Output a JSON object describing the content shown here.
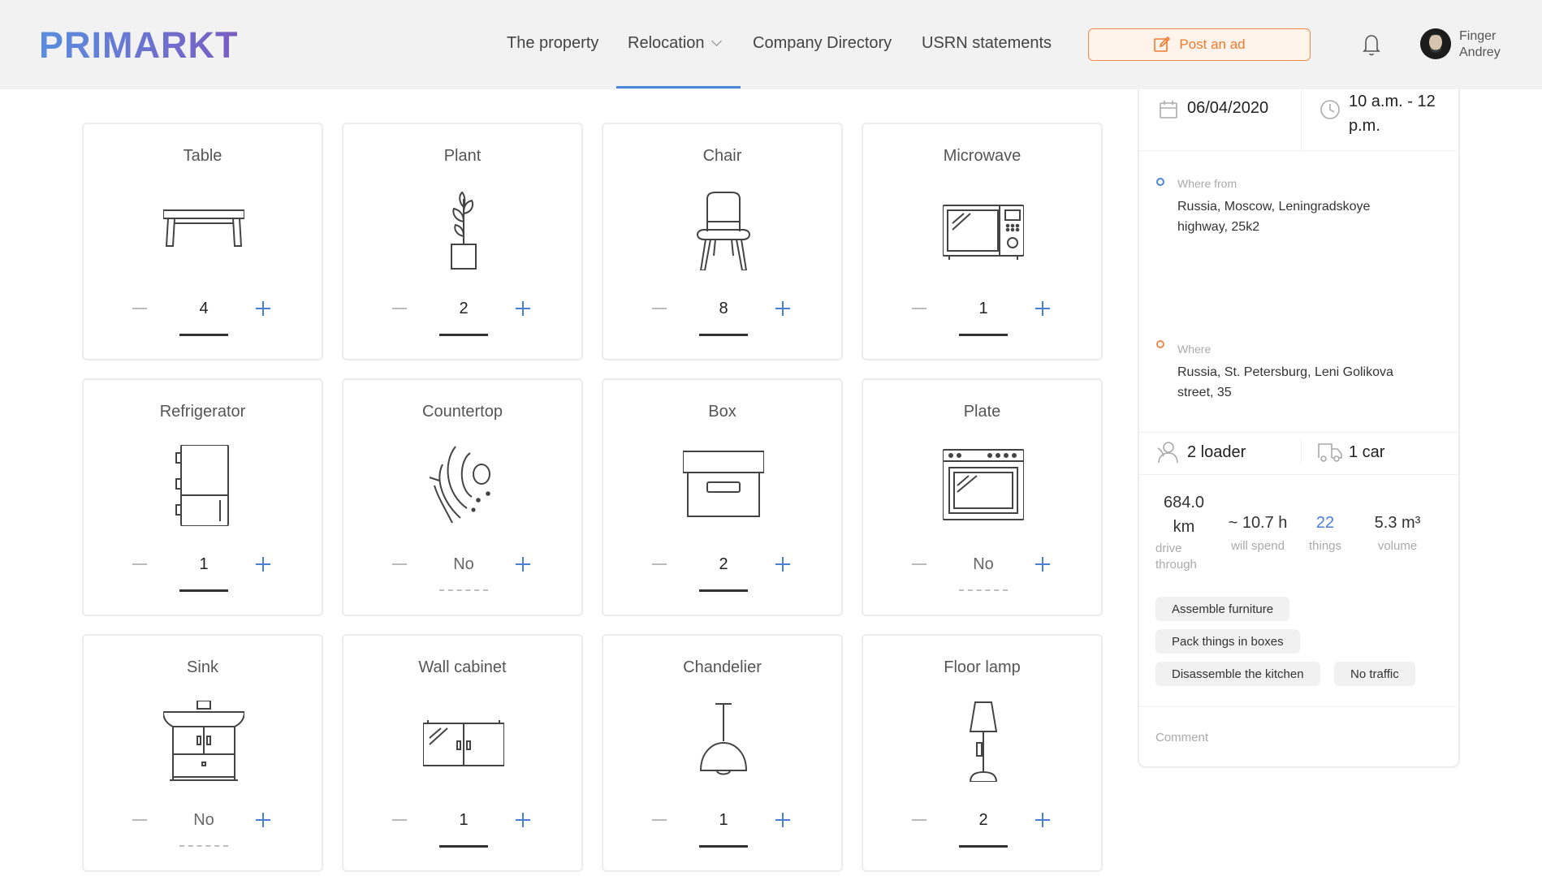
{
  "header": {
    "logo": "PRIMARKT",
    "nav": [
      "The property",
      "Relocation",
      "Company Directory",
      "USRN statements"
    ],
    "post_ad": "Post an ad",
    "user_first": "Finger",
    "user_last": "Andrey",
    "accent": "#4a86d9",
    "post_color": "#f07a2e"
  },
  "items": [
    {
      "name": "Table",
      "qty": "4",
      "icon": "table-icon"
    },
    {
      "name": "Plant",
      "qty": "2",
      "icon": "plant-icon"
    },
    {
      "name": "Chair",
      "qty": "8",
      "icon": "chair-icon"
    },
    {
      "name": "Microwave",
      "qty": "1",
      "icon": "microwave-icon"
    },
    {
      "name": "Refrigerator",
      "qty": "1",
      "icon": "refrigerator-icon"
    },
    {
      "name": "Countertop",
      "qty": "No",
      "icon": "countertop-icon"
    },
    {
      "name": "Box",
      "qty": "2",
      "icon": "box-icon"
    },
    {
      "name": "Plate",
      "qty": "No",
      "icon": "stove-icon"
    },
    {
      "name": "Sink",
      "qty": "No",
      "icon": "sink-icon"
    },
    {
      "name": "Wall cabinet",
      "qty": "1",
      "icon": "wall-cabinet-icon"
    },
    {
      "name": "Chandelier",
      "qty": "1",
      "icon": "chandelier-icon"
    },
    {
      "name": "Floor lamp",
      "qty": "2",
      "icon": "floor-lamp-icon"
    }
  ],
  "panel": {
    "date": "06/04/2020",
    "time_line1": "10 a.m. - 12",
    "time_line2": "p.m.",
    "from_label": "Where from",
    "from_line1": "Russia, Moscow, Leningradskoye",
    "from_line2": "highway, 25k2",
    "to_label": "Where",
    "to_line1": "Russia, St. Petersburg, Leni Golikova",
    "to_line2": "street, 35",
    "loaders": "2 loader",
    "cars": "1 car",
    "distance_line1": "684.0",
    "distance_line2": "km",
    "distance_label_line1": "drive",
    "distance_label_line2": "through",
    "hours": "~ 10.7 h",
    "hours_label": "will spend",
    "things": "22",
    "things_label": "things",
    "volume": "5.3 m³",
    "volume_label": "volume",
    "services": [
      "Assemble furniture",
      "Pack things in boxes",
      "Disassemble the kitchen",
      "No traffic"
    ],
    "comment_placeholder": "Comment"
  }
}
